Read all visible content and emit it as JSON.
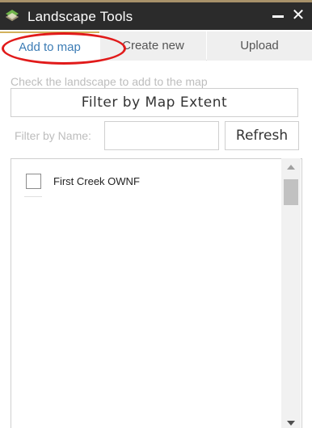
{
  "window": {
    "title": "Landscape Tools",
    "icon": "landscape-layers-icon",
    "minimize_icon": "minimize-icon",
    "close_icon": "close-icon",
    "close_glyph": "✕"
  },
  "tabs": [
    {
      "label": "Add to map",
      "active": true
    },
    {
      "label": "Create new",
      "active": false
    },
    {
      "label": "Upload",
      "active": false
    }
  ],
  "add_to_map": {
    "hint": "Check the landscape to add to the map",
    "filter_extent_label": "Filter by Map Extent",
    "filter_name_label": "Filter by Name:",
    "filter_name_value": "",
    "filter_name_placeholder": "",
    "refresh_label": "Refresh",
    "landscapes": [
      {
        "name": "First Creek OWNF",
        "checked": false
      }
    ]
  },
  "colors": {
    "titlebar_bg": "#2b2b2b",
    "active_tab_text": "#3c7cb5",
    "active_tab_accent": "#d2b15c",
    "annotation_circle": "#e11a1a",
    "placeholder_text": "#bdbdbd"
  }
}
